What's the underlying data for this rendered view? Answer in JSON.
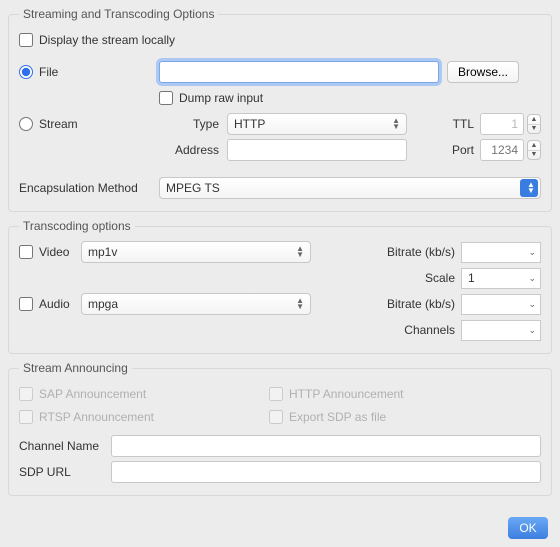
{
  "groups": {
    "streaming": {
      "title": "Streaming and Transcoding Options",
      "display_locally": "Display the stream locally",
      "file_label": "File",
      "file_value": "",
      "browse": "Browse...",
      "dump_raw": "Dump raw input",
      "stream_label": "Stream",
      "type_label": "Type",
      "type_value": "HTTP",
      "ttl_label": "TTL",
      "ttl_value": "1",
      "address_label": "Address",
      "address_value": "",
      "port_label": "Port",
      "port_value": "1234",
      "encapsulation_label": "Encapsulation Method",
      "encapsulation_value": "MPEG TS"
    },
    "transcoding": {
      "title": "Transcoding options",
      "video_label": "Video",
      "video_codec": "mp1v",
      "bitrate_label": "Bitrate (kb/s)",
      "video_bitrate": "",
      "scale_label": "Scale",
      "scale_value": "1",
      "audio_label": "Audio",
      "audio_codec": "mpga",
      "audio_bitrate": "",
      "channels_label": "Channels",
      "channels_value": ""
    },
    "announcing": {
      "title": "Stream Announcing",
      "sap": "SAP Announcement",
      "http": "HTTP Announcement",
      "rtsp": "RTSP Announcement",
      "export_sdp": "Export SDP as file",
      "channel_name_label": "Channel Name",
      "channel_name_value": "",
      "sdp_url_label": "SDP URL",
      "sdp_url_value": ""
    }
  },
  "ok": "OK"
}
